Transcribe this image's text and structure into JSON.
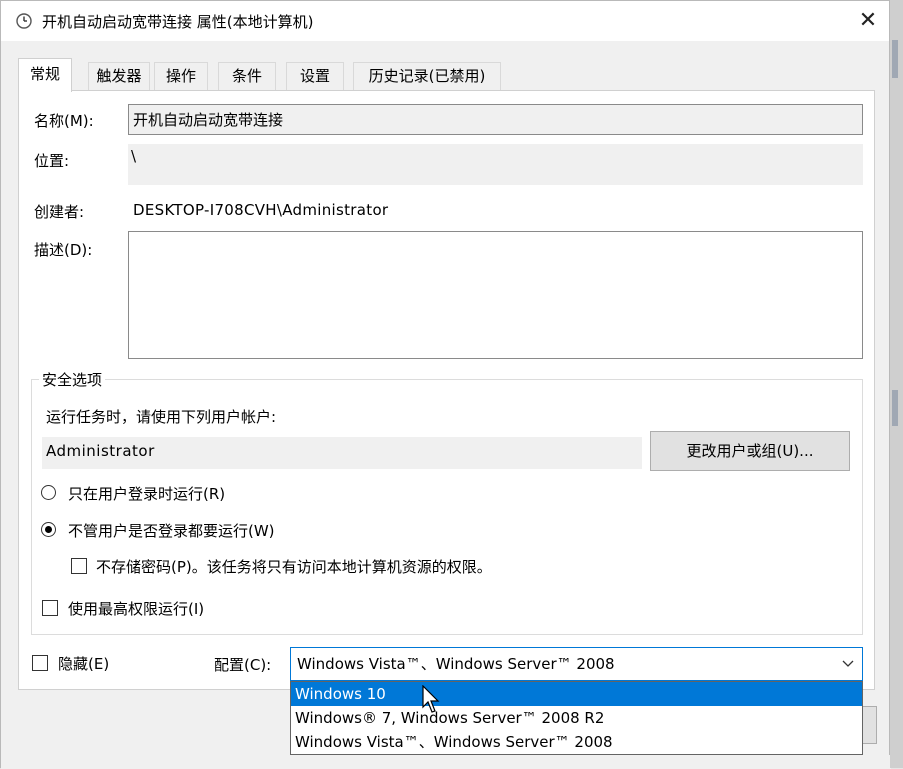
{
  "window": {
    "title": "开机自动启动宽带连接 属性(本地计算机)",
    "close_glyph": "✕"
  },
  "tabs": [
    {
      "label": "常规",
      "active": true
    },
    {
      "label": "触发器",
      "active": false
    },
    {
      "label": "操作",
      "active": false
    },
    {
      "label": "条件",
      "active": false
    },
    {
      "label": "设置",
      "active": false
    },
    {
      "label": "历史记录(已禁用)",
      "active": false
    }
  ],
  "general": {
    "name_label": "名称(M):",
    "name_value": "开机自动启动宽带连接",
    "location_label": "位置:",
    "location_value": "\\",
    "author_label": "创建者:",
    "author_value": "DESKTOP-I708CVH\\Administrator",
    "description_label": "描述(D):",
    "description_value": ""
  },
  "security": {
    "group_title": "安全选项",
    "run_as_prompt": "运行任务时，请使用下列用户帐户:",
    "user_account": "Administrator",
    "change_user_button": "更改用户或组(U)...",
    "run_only_logged_on": "只在用户登录时运行(R)",
    "run_whether_logged_on": "不管用户是否登录都要运行(W)",
    "selected_run_option": "run_whether_logged_on",
    "do_not_store_password": "不存储密码(P)。该任务将只有访问本地计算机资源的权限。",
    "do_not_store_password_checked": false,
    "run_highest_privileges": "使用最高权限运行(I)",
    "run_highest_privileges_checked": false
  },
  "bottom": {
    "hidden_label": "隐藏(E)",
    "hidden_checked": false,
    "configure_label": "配置(C):",
    "configure_value": "Windows Vista™、Windows Server™ 2008",
    "configure_options": [
      {
        "label": "Windows 10",
        "highlighted": true
      },
      {
        "label": "Windows® 7, Windows Server™ 2008 R2",
        "highlighted": false
      },
      {
        "label": "Windows Vista™、Windows Server™ 2008",
        "highlighted": false
      }
    ]
  },
  "colors": {
    "accent": "#0078d7",
    "window_bg": "#f0f0f0",
    "panel_bg": "#ffffff"
  },
  "icons": {
    "title": "clock-icon",
    "close": "close-icon",
    "dropdown": "chevron-down-icon",
    "cursor": "mouse-pointer-icon"
  }
}
